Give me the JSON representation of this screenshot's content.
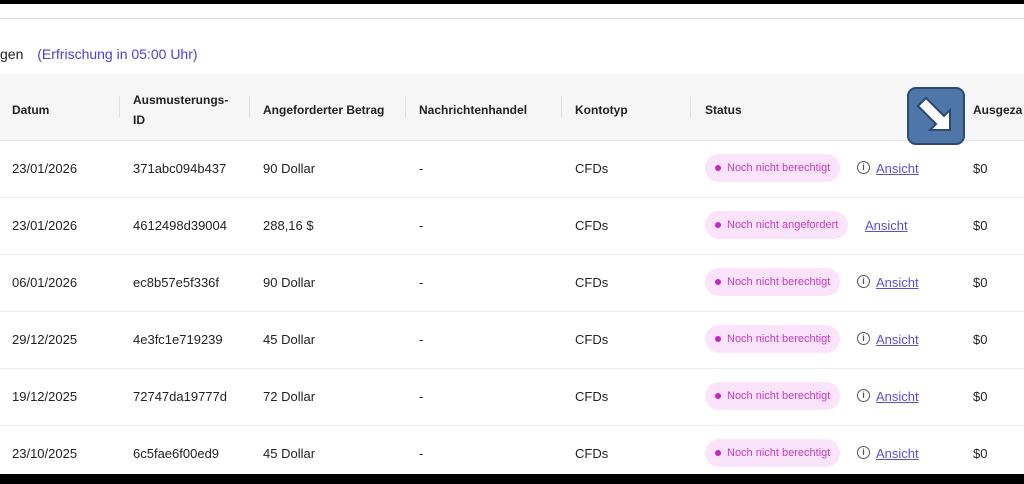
{
  "header": {
    "title_partial": "gen",
    "refresh": "(Erfrischung in 05:00 Uhr)"
  },
  "columns": {
    "datum": "Datum",
    "id": "Ausmusterungs-ID",
    "betrag": "Angeforderter Betrag",
    "nachrichten": "Nachrichtenhandel",
    "kontotyp": "Kontotyp",
    "status": "Status",
    "ausgezahlt": "Ausgeza"
  },
  "rows": [
    {
      "datum": "23/01/2026",
      "id": "371abc094b437",
      "betrag": "90 Dollar",
      "nachrichten": "-",
      "kontotyp": "CFDs",
      "status": "Noch nicht berechtigt",
      "info": true,
      "link": "Ansicht",
      "ausgezahlt": "$0"
    },
    {
      "datum": "23/01/2026",
      "id": "4612498d39004",
      "betrag": "288,16 $",
      "nachrichten": "-",
      "kontotyp": "CFDs",
      "status": "Noch nicht angefordert",
      "info": false,
      "link": "Ansicht",
      "ausgezahlt": "$0"
    },
    {
      "datum": "06/01/2026",
      "id": "ec8b57e5f336f",
      "betrag": "90 Dollar",
      "nachrichten": "-",
      "kontotyp": "CFDs",
      "status": "Noch nicht berechtigt",
      "info": true,
      "link": "Ansicht",
      "ausgezahlt": "$0"
    },
    {
      "datum": "29/12/2025",
      "id": "4e3fc1e719239",
      "betrag": "45 Dollar",
      "nachrichten": "-",
      "kontotyp": "CFDs",
      "status": "Noch nicht berechtigt",
      "info": true,
      "link": "Ansicht",
      "ausgezahlt": "$0"
    },
    {
      "datum": "19/12/2025",
      "id": "72747da19777d",
      "betrag": "72 Dollar",
      "nachrichten": "-",
      "kontotyp": "CFDs",
      "status": "Noch nicht berechtigt",
      "info": true,
      "link": "Ansicht",
      "ausgezahlt": "$0"
    },
    {
      "datum": "23/10/2025",
      "id": "6c5fae6f00ed9",
      "betrag": "45 Dollar",
      "nachrichten": "-",
      "kontotyp": "CFDs",
      "status": "Noch nicht berechtigt",
      "info": true,
      "link": "Ansicht",
      "ausgezahlt": "$0"
    }
  ],
  "colors": {
    "accent": "#5b4fd8",
    "badge_bg": "#fbe3fb",
    "badge_text": "#c43bc4",
    "header_bg": "#f6f6f7"
  },
  "icons": {
    "info": "info-icon",
    "cursor": "arrow-cursor-icon"
  }
}
